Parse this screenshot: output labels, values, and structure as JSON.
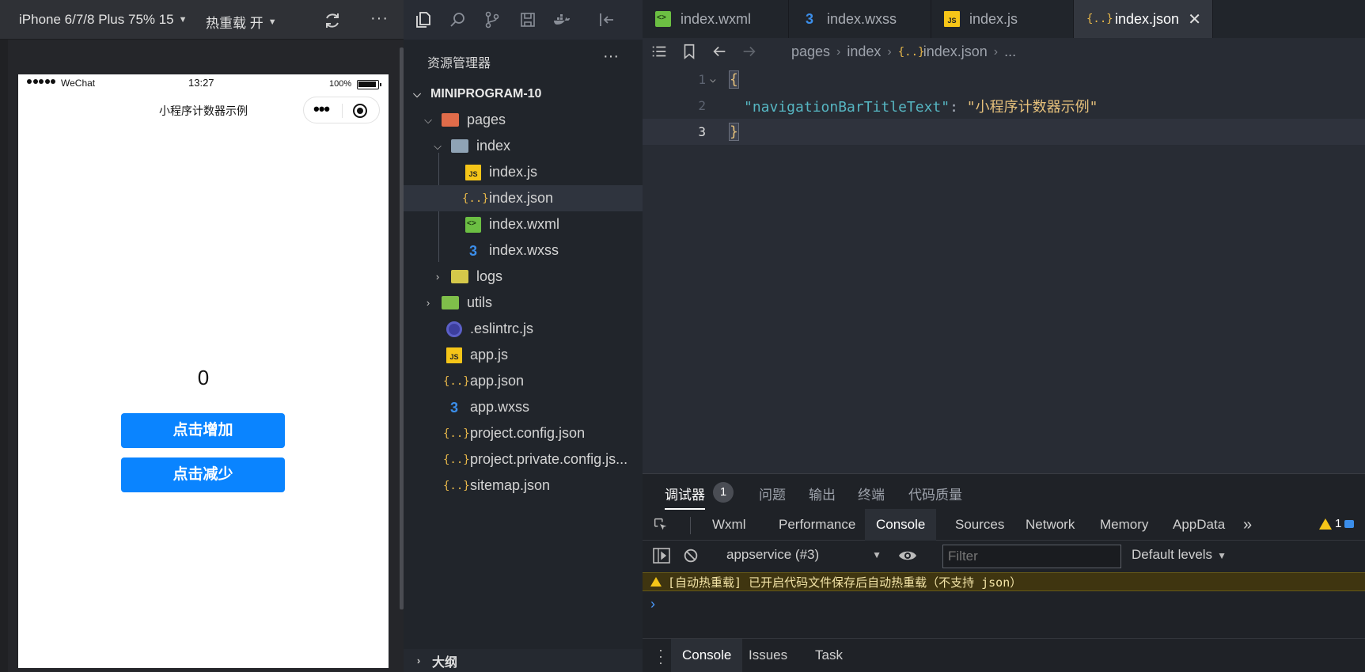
{
  "simulator": {
    "device": "iPhone 6/7/8 Plus 75% 15",
    "hot_reload": "热重载 开",
    "more": "···",
    "phone": {
      "carrier": "WeChat",
      "time": "13:27",
      "battery": "100%",
      "nav_title": "小程序计数器示例",
      "capsule_dots": "•••",
      "counter": "0",
      "btn_increase": "点击增加",
      "btn_decrease": "点击减少"
    }
  },
  "explorer": {
    "title": "资源管理器",
    "more": "···",
    "root": "MINIPROGRAM-10",
    "items": [
      {
        "label": "pages",
        "chev": "⌵",
        "icon": "folder-red"
      },
      {
        "label": "index",
        "chev": "⌵",
        "icon": "folder-open"
      },
      {
        "label": "index.js",
        "icon": "js"
      },
      {
        "label": "index.json",
        "icon": "json"
      },
      {
        "label": "index.wxml",
        "icon": "wxml"
      },
      {
        "label": "index.wxss",
        "icon": "css"
      },
      {
        "label": "logs",
        "chev": "›",
        "icon": "folder-yellow"
      },
      {
        "label": "utils",
        "chev": "›",
        "icon": "folder-green"
      },
      {
        "label": ".eslintrc.js",
        "icon": "eslint"
      },
      {
        "label": "app.js",
        "icon": "js"
      },
      {
        "label": "app.json",
        "icon": "json"
      },
      {
        "label": "app.wxss",
        "icon": "css"
      },
      {
        "label": "project.config.json",
        "icon": "json"
      },
      {
        "label": "project.private.config.js...",
        "icon": "json"
      },
      {
        "label": "sitemap.json",
        "icon": "json"
      }
    ],
    "outline": "大纲"
  },
  "editor": {
    "tabs": [
      {
        "label": "index.wxml",
        "icon": "wxml"
      },
      {
        "label": "index.wxss",
        "icon": "css"
      },
      {
        "label": "index.js",
        "icon": "js"
      },
      {
        "label": "index.json",
        "icon": "json",
        "active": true
      }
    ],
    "close_glyph": "✕",
    "breadcrumb": [
      "pages",
      "index",
      "index.json",
      "..."
    ],
    "lines": [
      "1",
      "2",
      "3"
    ],
    "code": {
      "open": "{",
      "key": "\"navigationBarTitleText\"",
      "colon": ": ",
      "value": "\"小程序计数器示例\"",
      "close": "}"
    }
  },
  "debug": {
    "tabs": [
      "调试器",
      "问题",
      "输出",
      "终端",
      "代码质量"
    ],
    "badge": "1",
    "devtools_tabs": [
      "Wxml",
      "Performance",
      "Console",
      "Sources",
      "Network",
      "Memory",
      "AppData"
    ],
    "more_tabs": "»",
    "warning_count": "1",
    "context": "appservice (#3)",
    "filter_placeholder": "Filter",
    "levels": "Default levels",
    "warn_message": "[自动热重载] 已开启代码文件保存后自动热重载（不支持 json）",
    "prompt": "›",
    "drawer_tabs": [
      "Console",
      "Issues",
      "Task"
    ]
  }
}
